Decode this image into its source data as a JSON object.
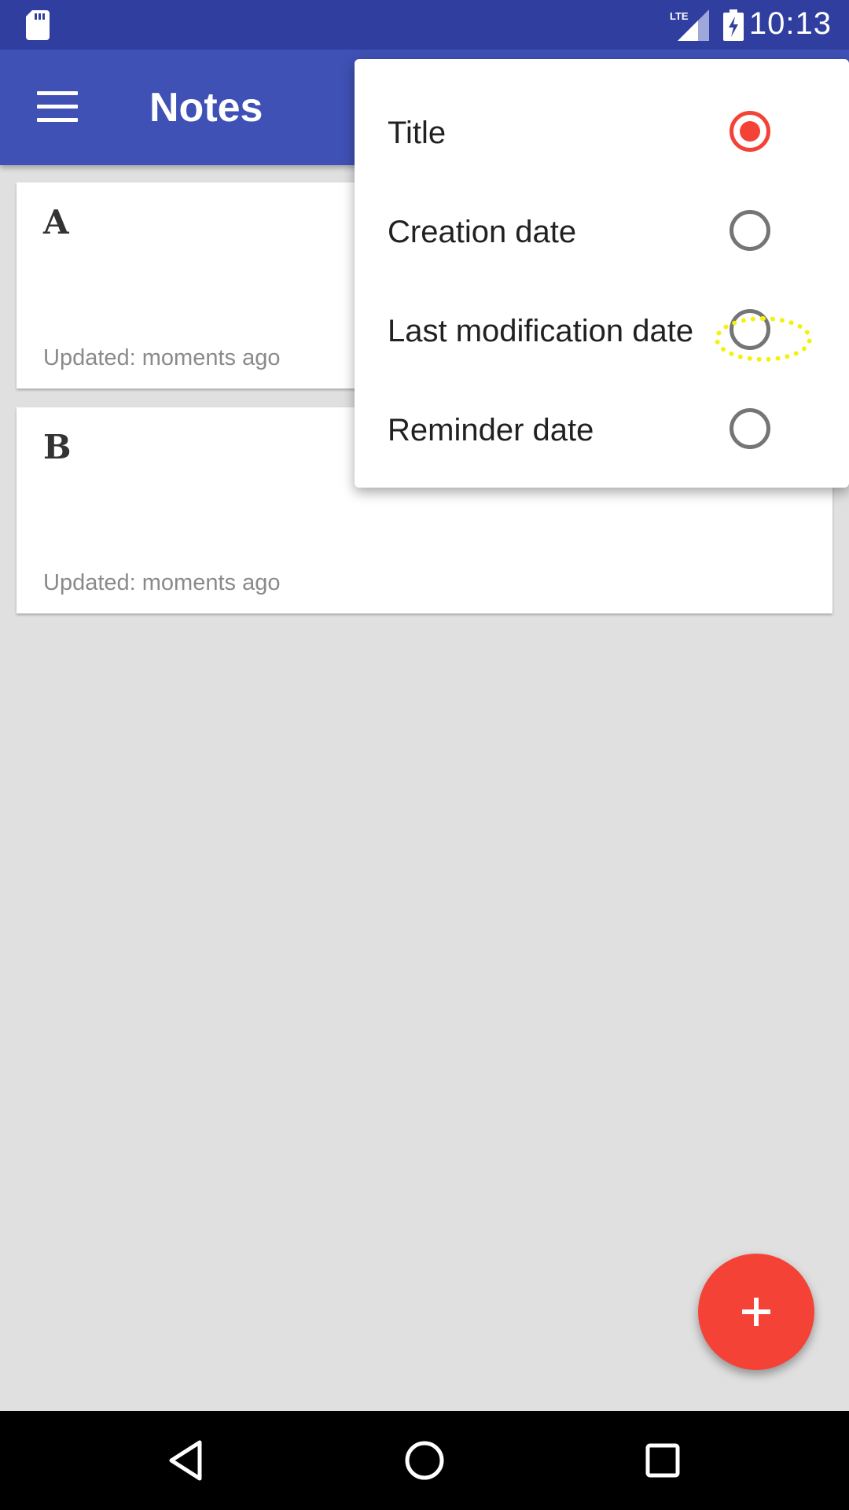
{
  "status_bar": {
    "time": "10:13",
    "network_label": "LTE",
    "icons": [
      "sd-card-icon",
      "lte-signal-icon",
      "battery-charging-icon"
    ]
  },
  "app_bar": {
    "title": "Notes",
    "menu_icon": "hamburger-menu-icon"
  },
  "notes": [
    {
      "title": "A",
      "updated": "Updated: moments ago"
    },
    {
      "title": "B",
      "updated": "Updated: moments ago"
    }
  ],
  "sort_menu": {
    "options": [
      {
        "label": "Title",
        "selected": true
      },
      {
        "label": "Creation date",
        "selected": false
      },
      {
        "label": "Last modification date",
        "selected": false
      },
      {
        "label": "Reminder date",
        "selected": false
      }
    ]
  },
  "fab": {
    "icon": "plus-icon"
  },
  "nav_bar": {
    "icons": [
      "back-icon",
      "home-icon",
      "recents-icon"
    ]
  },
  "colors": {
    "primary": "#3f51b5",
    "primary_dark": "#303f9f",
    "accent": "#f44336",
    "background": "#e0e0e0",
    "tap_highlight": "#f2f20a"
  }
}
